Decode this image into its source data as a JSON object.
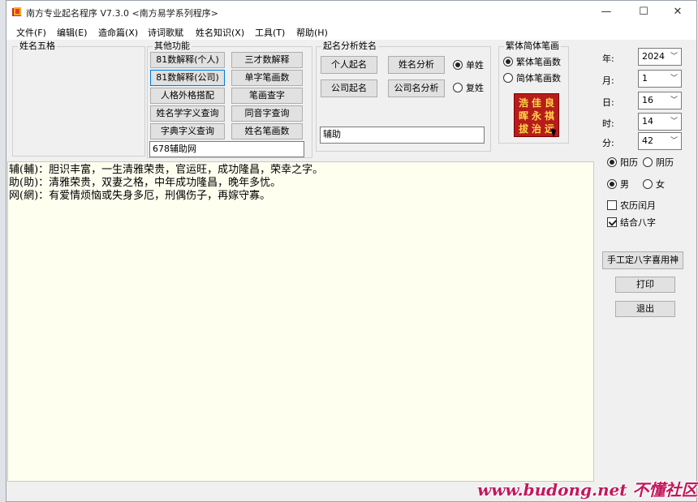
{
  "window": {
    "title": "南方专业起名程序 V7.3.0 <南方易学系列程序>",
    "minimize": "—",
    "maximize": "☐",
    "close": "✕"
  },
  "menu": [
    "文件(F)",
    "编辑(E)",
    "造命篇(X)",
    "诗词歌赋",
    "姓名知识(X)",
    "工具(T)",
    "帮助(H)"
  ],
  "groups": {
    "name_wuge": "姓名五格",
    "other_functions": "其他功能",
    "analysis": "起名分析姓名",
    "stroke": "繁体简体笔画"
  },
  "other_buttons": [
    "81数解释(个人)",
    "三才数解释",
    "81数解释(公司)",
    "单字笔画数",
    "人格外格搭配",
    "笔画查字",
    "姓名学字义查询",
    "同音字查询",
    "字典字义查询",
    "姓名笔画数"
  ],
  "other_input": "678辅助网",
  "analysis_buttons": [
    "个人起名",
    "姓名分析",
    "公司起名",
    "公司名分析"
  ],
  "surname_radios": [
    {
      "label": "单姓",
      "checked": true
    },
    {
      "label": "复姓",
      "checked": false
    }
  ],
  "analysis_input": "辅助",
  "stroke_radios": [
    {
      "label": "繁体笔画数",
      "checked": true
    },
    {
      "label": "简体笔画数",
      "checked": false
    }
  ],
  "stamp_chars": [
    "浩",
    "佳",
    "良",
    "晖",
    "永",
    "祺",
    "拔",
    "治",
    "远"
  ],
  "date": {
    "year_label": "年:",
    "year": "2024",
    "month_label": "月:",
    "month": "1",
    "day_label": "日:",
    "day": "16",
    "hour_label": "时:",
    "hour": "14",
    "minute_label": "分:",
    "minute": "42"
  },
  "calendar_radios": [
    {
      "label": "阳历",
      "checked": true
    },
    {
      "label": "阴历",
      "checked": false
    }
  ],
  "gender_radios": [
    {
      "label": "男",
      "checked": true
    },
    {
      "label": "女",
      "checked": false
    }
  ],
  "checks": [
    {
      "label": "农历闰月",
      "checked": false
    },
    {
      "label": "结合八字",
      "checked": true
    }
  ],
  "right_buttons": {
    "bazi": "手工定八字喜用神",
    "print": "打印",
    "exit": "退出"
  },
  "output_lines": [
    "辅(輔)：胆识丰富，一生清雅荣贵，官运旺，成功隆昌，荣幸之字。",
    "助(助)：清雅荣贵，双妻之格，中年成功隆昌，晚年多忧。",
    "网(網)：有爱情烦恼或失身多厄，刑偶伤子，再嫁守寡。"
  ],
  "watermark": "www.budong.net 不懂社区"
}
